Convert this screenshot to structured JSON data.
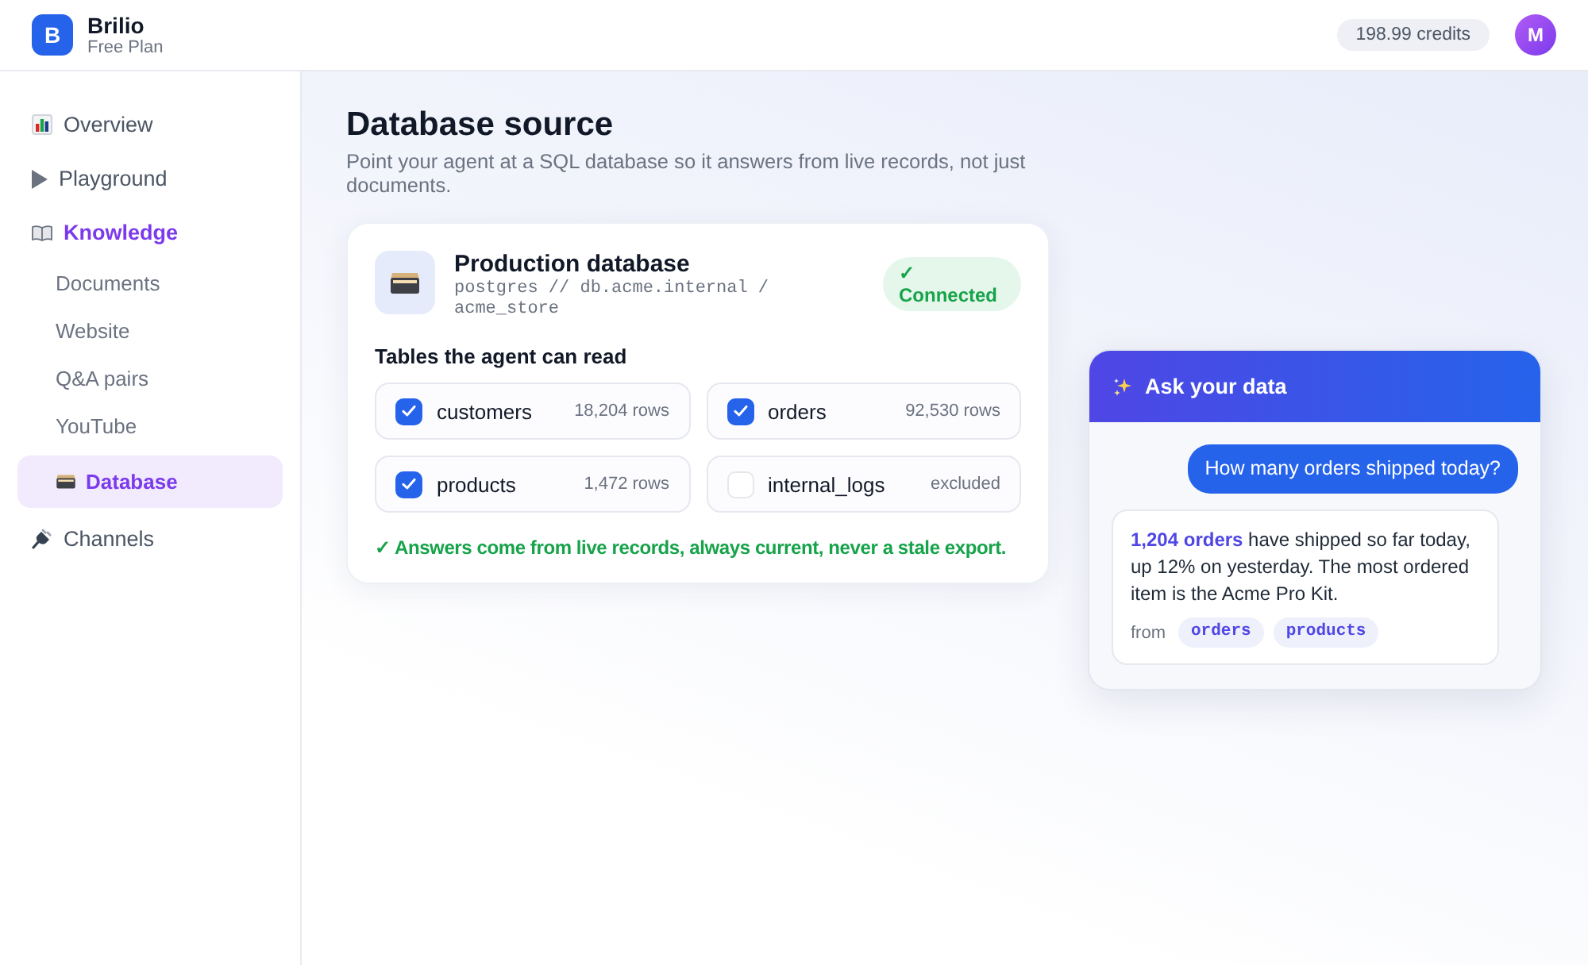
{
  "header": {
    "logo": "B",
    "name": "Brilio",
    "plan": "Free Plan",
    "credits": "198.99 credits",
    "avatar": "M"
  },
  "sidebar": {
    "items": [
      {
        "label": "Overview",
        "selected": false
      },
      {
        "label": "Playground",
        "selected": false
      },
      {
        "label": "Knowledge",
        "selected": true,
        "children": [
          {
            "label": "Documents",
            "selected": false
          },
          {
            "label": "Website",
            "selected": false
          },
          {
            "label": "Q&A pairs",
            "selected": false
          },
          {
            "label": "YouTube",
            "selected": false
          },
          {
            "label": "Database",
            "selected": true
          }
        ]
      },
      {
        "label": "Channels",
        "selected": false
      }
    ]
  },
  "page": {
    "title": "Database source",
    "subtitle": "Point your agent at a SQL database so it answers from live records, not just documents."
  },
  "connection": {
    "name": "Production database",
    "address": "postgres // db.acme.internal / acme_store",
    "status": "✓ Connected",
    "tables_heading": "Tables the agent can read",
    "tables": [
      {
        "name": "customers",
        "checked": true,
        "rows": "18,204 rows"
      },
      {
        "name": "orders",
        "checked": true,
        "rows": "92,530 rows"
      },
      {
        "name": "products",
        "checked": true,
        "rows": "1,472 rows"
      },
      {
        "name": "internal_logs",
        "checked": false,
        "rows": "excluded"
      }
    ],
    "note": "✓ Answers come from live records, always current, never a stale export."
  },
  "chat": {
    "title": "Ask your data",
    "messages": [
      {
        "kind": "question",
        "text": "How many orders shipped today?"
      },
      {
        "kind": "answer",
        "text": "**1,204 orders** have shipped so far today, up 12% on yesterday. The most ordered item is the Acme Pro Kit.",
        "sources_label": "from",
        "sources": [
          "orders",
          "products"
        ]
      }
    ]
  }
}
